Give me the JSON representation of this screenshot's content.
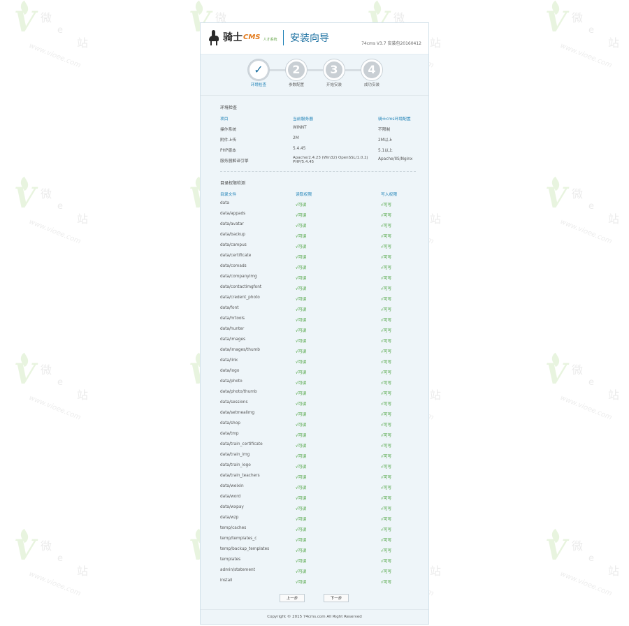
{
  "watermark": {
    "mark": "V",
    "text1": "微",
    "text2": "e",
    "text3": "站",
    "url": "www.vioee.com"
  },
  "header": {
    "brand": "骑士",
    "brand_cms": "CMS",
    "brand_sub": "人才系统",
    "title": "安装向导",
    "version": "74cms V3.7 安装包20160412"
  },
  "steps": [
    {
      "number": "✓",
      "label": "环境检查",
      "active": true
    },
    {
      "number": "2",
      "label": "参数配置",
      "active": false
    },
    {
      "number": "3",
      "label": "开始安装",
      "active": false
    },
    {
      "number": "4",
      "label": "成功安装",
      "active": false
    }
  ],
  "env": {
    "title": "环境检查",
    "headers": [
      "项目",
      "当前服务器",
      "骑士cms环境配置"
    ],
    "rows": [
      [
        "操作系统",
        "WINNT",
        "不限制"
      ],
      [
        "附件上传",
        "2M",
        "2M以上"
      ],
      [
        "PHP版本",
        "5.4.45",
        "5.1以上"
      ],
      [
        "服务器解译引擎",
        "Apache/2.4.23 (Win32) OpenSSL/1.0.2j PHP/5.4.45",
        "Apache/IIS/Nginx"
      ]
    ]
  },
  "dirs": {
    "title": "目录权限检测",
    "headers": [
      "目录文件",
      "读取权限",
      "写入权限"
    ],
    "read_status": "√可读",
    "write_status": "√可写",
    "items": [
      "data",
      "data/appads",
      "data/avatar",
      "data/backup",
      "data/campus",
      "data/certificate",
      "data/comads",
      "data/companyimg",
      "data/contactimgfont",
      "data/credent_photo",
      "data/font",
      "data/hrtools",
      "data/hunter",
      "data/images",
      "data/images/thumb",
      "data/link",
      "data/logo",
      "data/photo",
      "data/photo/thumb",
      "data/sessions",
      "data/setmealimg",
      "data/shop",
      "data/tmp",
      "data/train_certificate",
      "data/train_img",
      "data/train_logo",
      "data/train_teachers",
      "data/weixin",
      "data/word",
      "data/wxpay",
      "data/wzp",
      "temp/caches",
      "temp/templates_c",
      "temp/backup_templates",
      "templates",
      "admin/statement",
      "install"
    ]
  },
  "buttons": {
    "prev": "上一步",
    "next": "下一步"
  },
  "footer": {
    "copyright": "Copyright © 2015 74cms.com All Right Reserved"
  }
}
